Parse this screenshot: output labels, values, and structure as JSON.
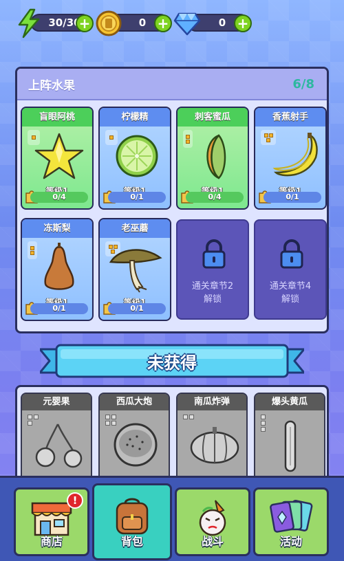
{
  "resources": {
    "energy": {
      "value": "30/30",
      "icon": "lightning-icon"
    },
    "coins": {
      "value": "0",
      "icon": "coin-icon"
    },
    "gems": {
      "value": "0",
      "icon": "diamond-icon"
    }
  },
  "roster": {
    "title": "上阵水果",
    "count": "6/8",
    "cards": [
      {
        "name": "盲眼阿桃",
        "level": "等级1",
        "progress": "0/4",
        "pieces": 1,
        "color": "green",
        "icon": "star-fruit-icon"
      },
      {
        "name": "柠檬精",
        "level": "等级1",
        "progress": "0/1",
        "pieces": 1,
        "color": "blue",
        "icon": "lime-icon"
      },
      {
        "name": "刺客蜜瓜",
        "level": "等级1",
        "progress": "0/4",
        "pieces": 2,
        "color": "green",
        "icon": "melon-slice-icon"
      },
      {
        "name": "香蕉射手",
        "level": "等级1",
        "progress": "0/1",
        "pieces": 3,
        "color": "blue",
        "icon": "banana-icon"
      },
      {
        "name": "冻斯梨",
        "level": "等级1",
        "progress": "0/1",
        "pieces": 2,
        "color": "blue",
        "icon": "pear-icon"
      },
      {
        "name": "老巫蘑",
        "level": "等级1",
        "progress": "0/1",
        "pieces": 3,
        "color": "blue",
        "icon": "mushroom-icon"
      }
    ],
    "locked": [
      {
        "line1": "通关章节2",
        "line2": "解锁",
        "icon": "padlock-icon"
      },
      {
        "line1": "通关章节4",
        "line2": "解锁",
        "icon": "padlock-icon"
      }
    ]
  },
  "banner": {
    "label": "未获得"
  },
  "unowned": [
    {
      "name": "元婴果",
      "icon": "cherry-icon"
    },
    {
      "name": "西瓜大炮",
      "icon": "watermelon-icon"
    },
    {
      "name": "南瓜炸弹",
      "icon": "pumpkin-icon"
    },
    {
      "name": "爆头黄瓜",
      "icon": "cucumber-icon"
    }
  ],
  "nav": {
    "shop": {
      "label": "商店",
      "badge": "!"
    },
    "bag": {
      "label": "背包"
    },
    "battle": {
      "label": "战斗"
    },
    "events": {
      "label": "活动"
    }
  }
}
